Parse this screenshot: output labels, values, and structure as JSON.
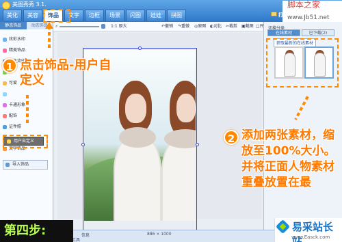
{
  "window": {
    "title": "美图秀秀 3.1.",
    "menu_tabs": [
      "美化",
      "美容",
      "饰品",
      "文字",
      "边框",
      "场景",
      "闪图",
      "娃娃",
      "拼图"
    ],
    "active_tab": "饰品",
    "open_label": "打开"
  },
  "sidebar": {
    "tabs": [
      "静态饰品",
      "动态饰品"
    ],
    "items": [
      "炫彩水印",
      "精美饰品",
      "非主流印",
      "",
      "可爱",
      "",
      "卡通形象",
      "配饰",
      "证件照",
      "",
      "文字饰品"
    ],
    "custom_label": "用户自定义",
    "import_label": "导入饰品"
  },
  "toolbar": {
    "original_size": "原大",
    "undo": "撤销",
    "redo": "重做",
    "reset": "原图",
    "compare": "对比",
    "crop": "裁剪",
    "screenshot": "截图",
    "size": "尺寸"
  },
  "right_panel": {
    "switch_label": "切换分类",
    "tabs": [
      "在线素材",
      "已下载(2)"
    ],
    "highlight": "获取最新的在线素材",
    "thumbnails": [
      "material-girl-front",
      "material-girl-side"
    ]
  },
  "statusbar": {
    "info": "信息",
    "dimension": "886 × 1000",
    "tool": "饰度工具"
  },
  "tutorial": {
    "step_one": "点击饰品-用户自定义",
    "step_two": "添加两张素材，缩放至100%大小。并将正面人物素材重叠放置在最",
    "step_label": "第四步:",
    "watermark_cn": "脚本之家",
    "watermark_en": "www.Jb51.net",
    "brand": "易采站长站",
    "brand_domain": "www.Easck.com"
  },
  "colors": {
    "accent": "#ff8a00",
    "window_blue": "#2f78c9",
    "selection": "#3347d1"
  }
}
